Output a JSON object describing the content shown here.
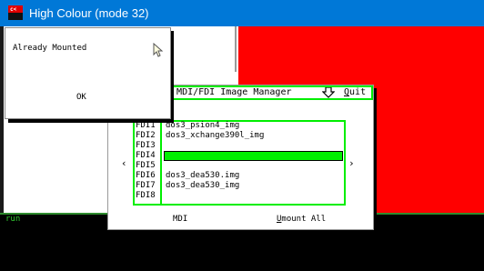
{
  "window": {
    "title": "High Colour (mode 32)",
    "icon": "app-icon"
  },
  "alert": {
    "message": "Already Mounted",
    "ok_label": "OK"
  },
  "terminal": {
    "prompt": "run"
  },
  "fdi_manager": {
    "title": "n  MDI/FDI Image Manager",
    "quit_icon": "download-arrow-icon",
    "quit_label": "Quit",
    "quit_underlined": "Q",
    "quit_rest": "uit",
    "slots": [
      {
        "label": "FDI1",
        "image": "dos3_psion4_img"
      },
      {
        "label": "FDI2",
        "image": "dos3_xchange390l_img"
      },
      {
        "label": "FDI3",
        "image": ""
      },
      {
        "label": "FDI4",
        "image": ""
      },
      {
        "label": "FDI5",
        "image": ""
      },
      {
        "label": "FDI6",
        "image": "dos3_dea530.img"
      },
      {
        "label": "FDI7",
        "image": "dos3_dea530_img"
      },
      {
        "label": "FDI8",
        "image": ""
      }
    ],
    "selected_slot": "FDI4",
    "prev_arrow": "‹",
    "next_arrow": "›",
    "mdi_label": "MDI",
    "umount_underlined": "U",
    "umount_rest": "mount All"
  },
  "colors": {
    "titlebar": "#0078d7",
    "highlight_green": "#00ee00",
    "red_panel": "#ff0000"
  }
}
